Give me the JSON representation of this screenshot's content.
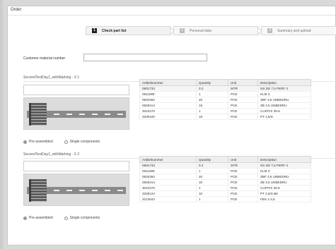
{
  "window": {
    "title": "Order"
  },
  "steps": [
    {
      "num": "1",
      "label": "Check part list",
      "active": true
    },
    {
      "num": "2",
      "label": "Personal data",
      "active": false
    },
    {
      "num": "3",
      "label": "Summary and upload",
      "active": false
    }
  ],
  "customer_material": {
    "label": "Customer material number",
    "value": "",
    "placeholder": ""
  },
  "sections": [
    {
      "title": "SecondTestDay1_withMarking - X 1",
      "radio_preassembled": "Pre-assembled",
      "radio_single": "Single components",
      "selected": "preassembled",
      "table": {
        "columns": [
          "Artikelnummer",
          "Quantity",
          "Unit",
          "Description"
        ],
        "rows": [
          [
            "0801733",
            "0.2",
            "MTR",
            "NS 35/ 7,5 PERF 2"
          ],
          [
            "0811088",
            "1",
            "PCE",
            "KLM 3"
          ],
          [
            "0820392",
            "20",
            "PCE",
            "ZBF 3,5 UNBEDRU"
          ],
          [
            "0828414",
            "16",
            "PCE",
            "ZB 3,5 UNBEDRU"
          ],
          [
            "3022276",
            "1",
            "PCE",
            "CLIPFIX 35-5"
          ],
          [
            "3206100",
            "16",
            "PCE",
            "PT 1,5/S"
          ]
        ]
      }
    },
    {
      "title": "SecondTestDay1_withMarking - X 2",
      "radio_preassembled": "Pre-assembled",
      "radio_single": "Single components",
      "selected": "preassembled",
      "table": {
        "columns": [
          "Artikelnummer",
          "Quantity",
          "Unit",
          "Description"
        ],
        "rows": [
          [
            "0801733",
            "0.2",
            "MTR",
            "NS 35/ 7,5 PERF 2"
          ],
          [
            "0811088",
            "1",
            "PCE",
            "KLM 3"
          ],
          [
            "0820392",
            "20",
            "PCE",
            "ZBF 3,5 UNBEDRU"
          ],
          [
            "0828414",
            "10",
            "PCE",
            "ZB 3,5 UNBEDRU"
          ],
          [
            "3022276",
            "1",
            "PCE",
            "CLIPFIX 35-5"
          ],
          [
            "3208124",
            "10",
            "PCE",
            "PT 1,5/S BK"
          ],
          [
            "3213043",
            "1",
            "PCE",
            "FBS 1-3,5"
          ]
        ]
      }
    }
  ],
  "colors": {
    "background": "#d9d9d9",
    "window": "#ffffff",
    "active_step_number": "#222222"
  }
}
